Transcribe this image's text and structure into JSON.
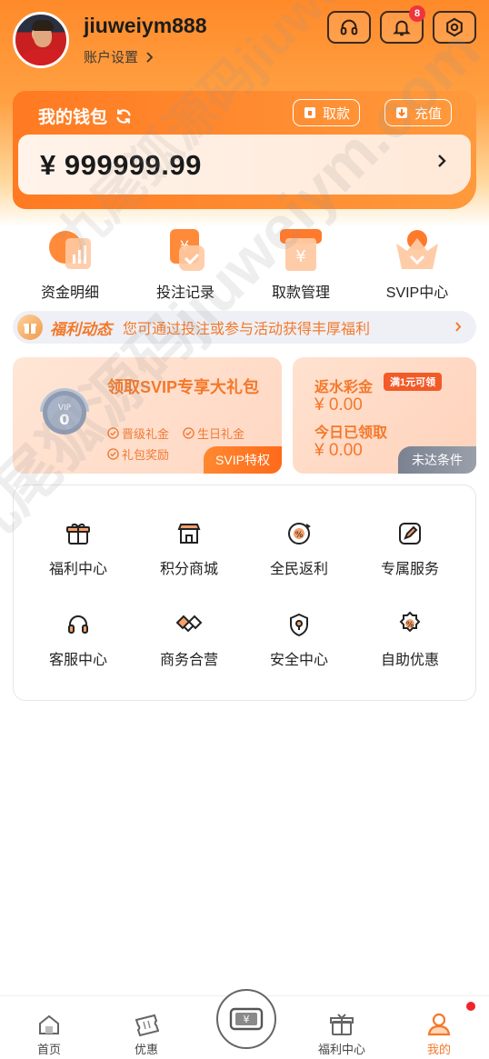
{
  "header": {
    "username": "jiuweiym888",
    "account_settings_label": "账户设置",
    "notification_count": "8"
  },
  "wallet": {
    "title": "我的钱包",
    "withdraw_label": "取款",
    "deposit_label": "充值",
    "balance": "¥ 999999.99"
  },
  "quick_actions": [
    {
      "label": "资金明细",
      "icon": "fund-details-icon"
    },
    {
      "label": "投注记录",
      "icon": "bet-record-icon"
    },
    {
      "label": "取款管理",
      "icon": "withdraw-manage-icon"
    },
    {
      "label": "SVIP中心",
      "icon": "svip-center-icon"
    }
  ],
  "notice": {
    "title": "福利动态",
    "text": "您可通过投注或参与活动获得丰厚福利"
  },
  "vip_card": {
    "title": "领取SVIP专享大礼包",
    "medal_text": "VIP",
    "medal_level": "0",
    "tags": [
      "晋级礼金",
      "生日礼金",
      "礼包奖励"
    ],
    "button": "SVIP特权"
  },
  "rebate_card": {
    "rebate_label": "返水彩金",
    "rebate_tag": "满1元可领",
    "rebate_value": "¥ 0.00",
    "today_label": "今日已领取",
    "today_value": "¥ 0.00",
    "button": "未达条件"
  },
  "services": [
    {
      "label": "福利中心",
      "icon": "gift-icon"
    },
    {
      "label": "积分商城",
      "icon": "store-icon"
    },
    {
      "label": "全民返利",
      "icon": "rebate-icon"
    },
    {
      "label": "专属服务",
      "icon": "edit-service-icon"
    },
    {
      "label": "客服中心",
      "icon": "headset-icon"
    },
    {
      "label": "商务合营",
      "icon": "handshake-icon"
    },
    {
      "label": "安全中心",
      "icon": "shield-icon"
    },
    {
      "label": "自助优惠",
      "icon": "discount-icon"
    }
  ],
  "watermark": "九尾狐源码jiuweiym.com",
  "bottom_nav": [
    {
      "label": "首页"
    },
    {
      "label": "优惠"
    },
    {
      "label": "福利中心"
    },
    {
      "label": "我的"
    }
  ],
  "colors": {
    "accent": "#ff7a22",
    "accent_text": "#f4782a",
    "badge": "#f0343c"
  }
}
